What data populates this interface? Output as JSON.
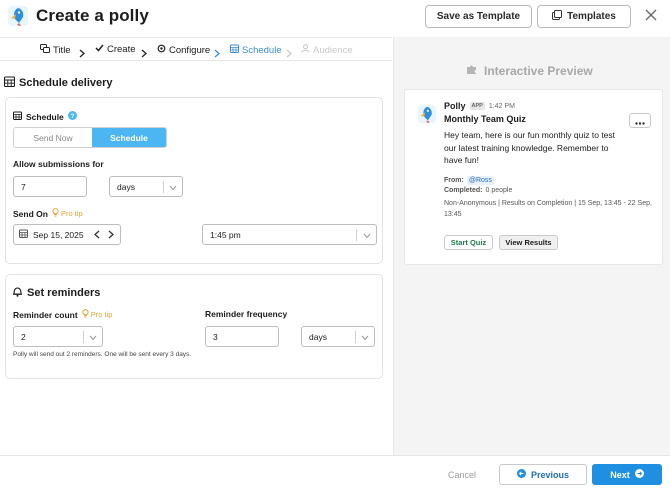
{
  "header": {
    "title": "Create a polly",
    "save_template_label": "Save as Template",
    "templates_label": "Templates"
  },
  "stepper": {
    "steps": [
      {
        "label": "Title",
        "state": "done"
      },
      {
        "label": "Create",
        "state": "done"
      },
      {
        "label": "Configure",
        "state": "done"
      },
      {
        "label": "Schedule",
        "state": "active"
      },
      {
        "label": "Audience",
        "state": "disabled"
      }
    ]
  },
  "schedule_delivery": {
    "title": "Schedule delivery",
    "schedule_label": "Schedule",
    "toggle": {
      "send_now": "Send Now",
      "schedule": "Schedule",
      "selected": "Schedule"
    },
    "allow_label": "Allow submissions for",
    "allow_value": "7",
    "allow_unit": "days",
    "send_on_label": "Send On",
    "pro_tip": "Pro tip",
    "date_value": "Sep 15, 2025",
    "time_value": "1:45 pm"
  },
  "reminders": {
    "title": "Set reminders",
    "count_label": "Reminder count",
    "pro_tip": "Pro tip",
    "count_value": "2",
    "frequency_label": "Reminder frequency",
    "frequency_value": "3",
    "frequency_unit": "days",
    "note": "Polly will send out 2 reminders. One will be sent every 3 days."
  },
  "preview": {
    "title": "Interactive Preview",
    "app_name": "Polly",
    "app_badge": "APP",
    "time": "1:42 PM",
    "quiz_title": "Monthly Team Quiz",
    "message": "Hey team, here is our fun monthly quiz to test our latest training knowledge. Remember to have fun!",
    "from_label": "From:",
    "from_value": "@Ross",
    "completed_label": "Completed:",
    "completed_value": "0 people",
    "meta_line": "Non-Anonymous | Results on Completion | 15 Sep, 13:45 - 22 Sep, 13:45",
    "start_label": "Start Quiz",
    "results_label": "View Results"
  },
  "footer": {
    "cancel_label": "Cancel",
    "previous_label": "Previous",
    "next_label": "Next"
  },
  "colors": {
    "accent": "#1e8fe1",
    "schedule_toggle": "#4cb6f2",
    "pro_tip": "#e2a43a",
    "step_active": "#3b8ed6"
  }
}
